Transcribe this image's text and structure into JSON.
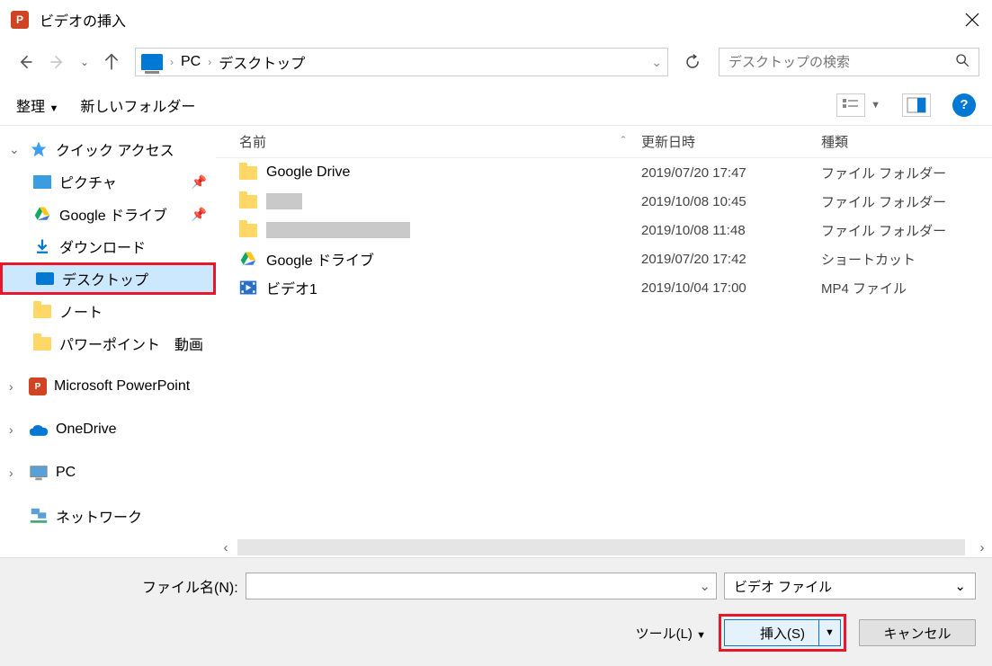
{
  "window": {
    "title": "ビデオの挿入"
  },
  "breadcrumb": {
    "items": [
      "PC",
      "デスクトップ"
    ]
  },
  "search": {
    "placeholder": "デスクトップの検索"
  },
  "toolbar": {
    "organize": "整理",
    "new_folder": "新しいフォルダー"
  },
  "sidebar": {
    "quick_access": "クイック アクセス",
    "pictures": "ピクチャ",
    "gdrive": "Google ドライブ",
    "downloads": "ダウンロード",
    "desktop": "デスクトップ",
    "notes": "ノート",
    "pp_video": "パワーポイント　動画",
    "ms_pp": "Microsoft PowerPoint",
    "onedrive": "OneDrive",
    "pc": "PC",
    "network": "ネットワーク"
  },
  "columns": {
    "name": "名前",
    "date": "更新日時",
    "type": "種類"
  },
  "files": [
    {
      "name": "Google Drive",
      "date": "2019/07/20 17:47",
      "type": "ファイル フォルダー",
      "icon": "folder"
    },
    {
      "name": "",
      "date": "2019/10/08 10:45",
      "type": "ファイル フォルダー",
      "icon": "folder",
      "redact_w": 40
    },
    {
      "name": "",
      "date": "2019/10/08 11:48",
      "type": "ファイル フォルダー",
      "icon": "folder",
      "redact_w": 160
    },
    {
      "name": "Google ドライブ",
      "date": "2019/07/20 17:42",
      "type": "ショートカット",
      "icon": "gdrive"
    },
    {
      "name": "ビデオ1",
      "date": "2019/10/04 17:00",
      "type": "MP4 ファイル",
      "icon": "video"
    }
  ],
  "footer": {
    "filename_label": "ファイル名(N):",
    "filter": "ビデオ ファイル",
    "tools": "ツール(L)",
    "insert": "挿入(S)",
    "cancel": "キャンセル"
  }
}
